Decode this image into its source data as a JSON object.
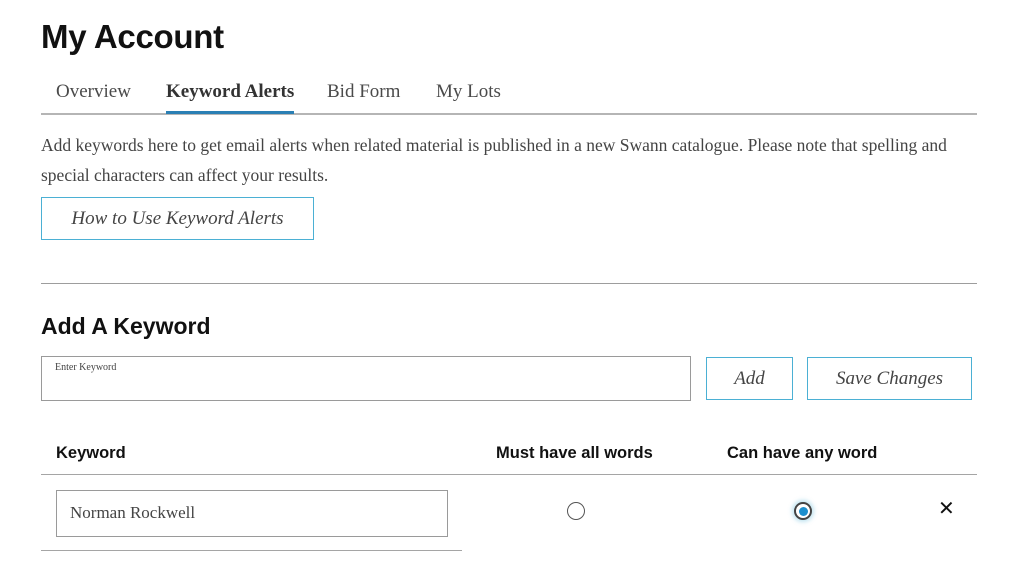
{
  "header": {
    "title": "My Account"
  },
  "tabs": [
    {
      "label": "Overview",
      "active": false
    },
    {
      "label": "Keyword Alerts",
      "active": true
    },
    {
      "label": "Bid Form",
      "active": false
    },
    {
      "label": "My Lots",
      "active": false
    }
  ],
  "intro": {
    "text": "Add keywords here to get email alerts when related material is published in a new Swann catalogue. Please note that spelling and special characters can affect your results.",
    "how_to_button": "How to Use Keyword Alerts"
  },
  "add_keyword": {
    "title": "Add A Keyword",
    "field_label": "Enter Keyword",
    "field_value": "",
    "add_button": "Add",
    "save_button": "Save Changes"
  },
  "table": {
    "headers": {
      "keyword": "Keyword",
      "must_have_all": "Must have all words",
      "can_have_any": "Can have any word"
    },
    "rows": [
      {
        "keyword": "Norman Rockwell",
        "match_mode": "any",
        "remove_icon": "close-icon"
      }
    ]
  },
  "colors": {
    "accent": "#2a7fb4",
    "button_border": "#4bb0d4",
    "radio_selected": "#1c8fce"
  }
}
